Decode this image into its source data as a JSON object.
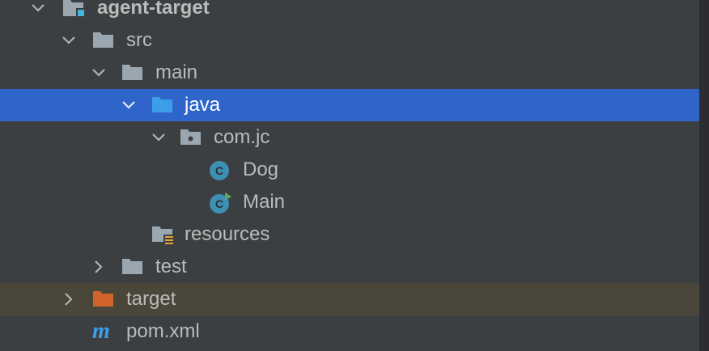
{
  "tree": {
    "items": [
      {
        "label": "agent-target",
        "icon": "module-folder-icon",
        "expanded": true
      },
      {
        "label": "src",
        "icon": "folder-icon",
        "expanded": true
      },
      {
        "label": "main",
        "icon": "folder-icon",
        "expanded": true
      },
      {
        "label": "java",
        "icon": "source-root-folder-icon",
        "expanded": true,
        "selected": true
      },
      {
        "label": "com.jc",
        "icon": "package-folder-icon",
        "expanded": true
      },
      {
        "label": "Dog",
        "icon": "java-class-icon"
      },
      {
        "label": "Main",
        "icon": "java-runnable-class-icon"
      },
      {
        "label": "resources",
        "icon": "resources-folder-icon"
      },
      {
        "label": "test",
        "icon": "folder-icon",
        "expanded": false
      },
      {
        "label": "target",
        "icon": "excluded-folder-icon",
        "expanded": false
      },
      {
        "label": "pom.xml",
        "icon": "maven-icon"
      }
    ]
  },
  "colors": {
    "selection": "#2f65ca",
    "excluded_row": "#4a4639",
    "panel_bg": "#3c3f41",
    "folder": "#9aa7b0",
    "source_folder": "#3d9ee8",
    "excluded_folder": "#d0642a",
    "class_icon": "#3d8fb3",
    "run_badge": "#59a869"
  }
}
